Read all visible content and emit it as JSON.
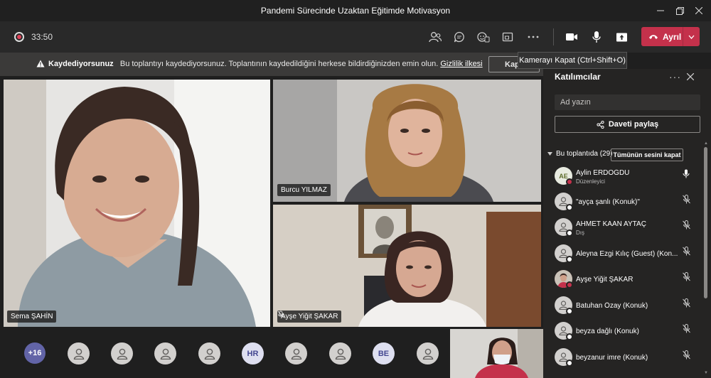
{
  "window": {
    "title": "Pandemi Sürecinde Uzaktan Eğitimde Motivasyon",
    "controls": [
      "minimize-icon",
      "restore-icon",
      "close-icon"
    ]
  },
  "toolbar": {
    "timer": "33:50",
    "icons": [
      "people-icon",
      "chat-icon",
      "reactions-icon",
      "share-tray-icon",
      "more-icon",
      "camera-icon",
      "mic-icon",
      "share-screen-icon"
    ],
    "leave_label": "Ayrıl",
    "tooltip": "Kamerayı Kapat (Ctrl+Shift+O)"
  },
  "banner": {
    "title": "Kaydediyorsunuz",
    "message": "Bu toplantıyı kaydediyorsunuz. Toplantının kaydedildiğini herkese bildirdiğinizden emin olun.",
    "link": "Gizlilik ilkesi",
    "button": "Kapat"
  },
  "videos": [
    {
      "name": "Sema ŞAHİN",
      "muted": false
    },
    {
      "name": "Burcu YILMAZ",
      "muted": false
    },
    {
      "name": "Ayşe Yiğit ŞAKAR",
      "muted": true
    }
  ],
  "bottom_strip": {
    "overflow": "+16",
    "avatars": [
      "person",
      "person",
      "person",
      "person",
      "HR",
      "person",
      "person",
      "BE",
      "person"
    ]
  },
  "panel": {
    "title": "Katılımcılar",
    "search_placeholder": "Ad yazın",
    "share_label": "Daveti paylaş",
    "section_label": "Bu toplantıda (29)",
    "mute_all": "Tümünün sesini kapat",
    "participants": [
      {
        "name": "Aylin ERDOĞDU",
        "sub": "Düzenleyici",
        "avatar": "AE",
        "mic": "on"
      },
      {
        "name": "\"ayça şanlı (Konuk)\"",
        "sub": "",
        "avatar": "person",
        "mic": "off"
      },
      {
        "name": "AHMET KAAN AYTAÇ",
        "sub": "Dış",
        "avatar": "person",
        "mic": "off"
      },
      {
        "name": "Aleyna Ezgi Kılıç (Guest) (Kon...",
        "sub": "",
        "avatar": "person",
        "mic": "off"
      },
      {
        "name": "Ayşe Yiğit ŞAKAR",
        "sub": "",
        "avatar": "photo",
        "mic": "off"
      },
      {
        "name": "Batuhan Özay (Konuk)",
        "sub": "",
        "avatar": "person",
        "mic": "off"
      },
      {
        "name": "beyza dağlı (Konuk)",
        "sub": "",
        "avatar": "person",
        "mic": "off"
      },
      {
        "name": "beyzanur imre (Konuk)",
        "sub": "",
        "avatar": "person",
        "mic": "off"
      }
    ]
  },
  "colors": {
    "accent": "#6264a7",
    "leave": "#c4314b",
    "background": "#1f1f1f",
    "panel": "#252423"
  }
}
